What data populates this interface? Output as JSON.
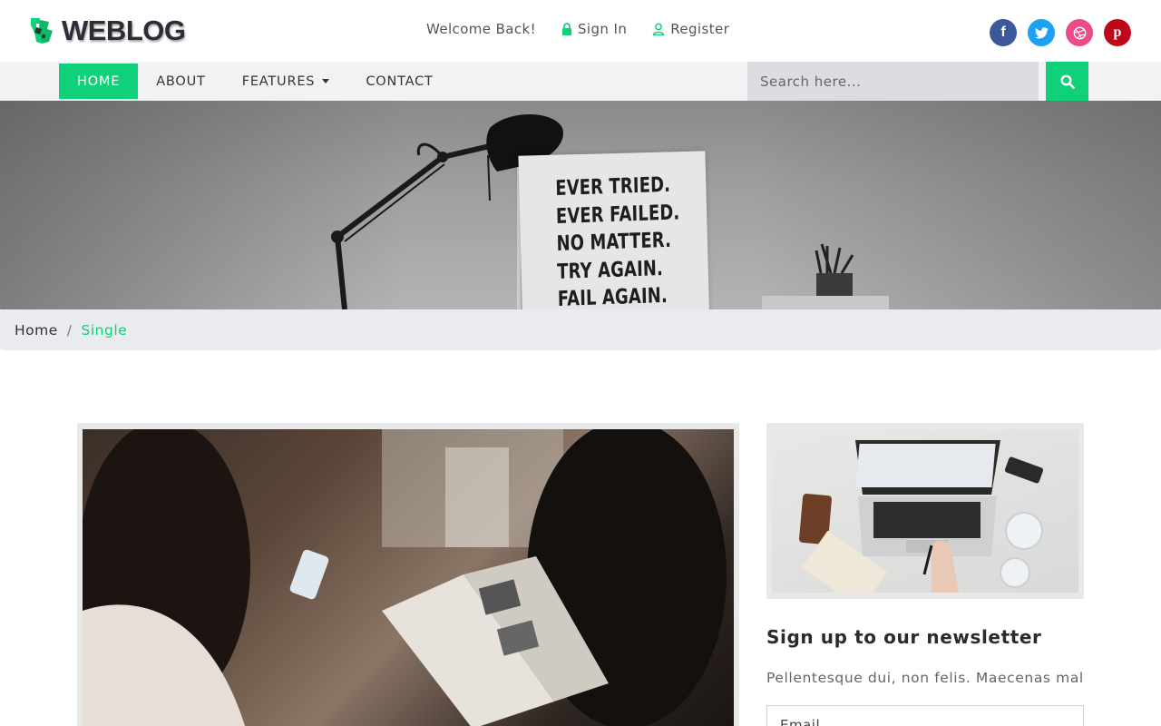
{
  "brand": {
    "name": "WEBLOG",
    "accent": "#10d07a"
  },
  "topbar": {
    "welcome": "Welcome Back!",
    "sign_in": "Sign In",
    "register": "Register",
    "socials": [
      {
        "icon": "facebook-icon",
        "glyph": "f",
        "color": "#3b5998"
      },
      {
        "icon": "twitter-icon",
        "glyph": "t",
        "color": "#1da1f2"
      },
      {
        "icon": "dribbble-icon",
        "glyph": "d",
        "color": "#ea4c89"
      },
      {
        "icon": "pinterest-icon",
        "glyph": "p",
        "color": "#bd081c"
      }
    ]
  },
  "nav": {
    "items": [
      {
        "label": "HOME",
        "active": true
      },
      {
        "label": "ABOUT",
        "active": false
      },
      {
        "label": "FEATURES",
        "active": false,
        "dropdown": true
      },
      {
        "label": "CONTACT",
        "active": false
      }
    ],
    "search_placeholder": "Search here..."
  },
  "hero": {
    "poster_lines": [
      "EVER TRIED.",
      "EVER FAILED.",
      "NO MATTER.",
      "TRY AGAIN.",
      "FAIL AGAIN."
    ]
  },
  "breadcrumb": {
    "home": "Home",
    "separator": "/",
    "current": "Single"
  },
  "sidebar": {
    "newsletter_title": "Sign up to our newsletter",
    "newsletter_desc": "Pellentesque dui, non felis. Maecenas male",
    "email_placeholder": "Email"
  }
}
